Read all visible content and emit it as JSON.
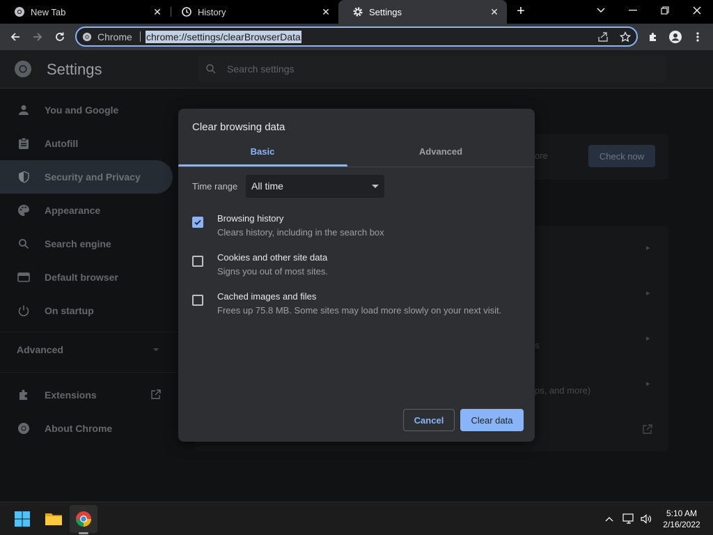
{
  "browser": {
    "tabs": [
      {
        "label": "New Tab",
        "icon": "chrome-icon",
        "active": false
      },
      {
        "label": "History",
        "icon": "history-icon",
        "active": false
      },
      {
        "label": "Settings",
        "icon": "gear-icon",
        "active": true
      }
    ],
    "omnibox": {
      "chip_label": "Chrome",
      "url": "chrome://settings/clearBrowserData"
    }
  },
  "settings": {
    "title": "Settings",
    "search_placeholder": "Search settings",
    "sidebar": {
      "items": [
        {
          "label": "You and Google",
          "icon": "person-icon"
        },
        {
          "label": "Autofill",
          "icon": "clipboard-icon"
        },
        {
          "label": "Security and Privacy",
          "icon": "shield-icon",
          "active": true
        },
        {
          "label": "Appearance",
          "icon": "palette-icon"
        },
        {
          "label": "Search engine",
          "icon": "search-icon"
        },
        {
          "label": "Default browser",
          "icon": "browser-window-icon"
        },
        {
          "label": "On startup",
          "icon": "power-icon"
        }
      ],
      "advanced_label": "Advanced",
      "footer_items": [
        {
          "label": "Extensions",
          "icon": "puzzle-icon"
        },
        {
          "label": "About Chrome",
          "icon": "chrome-icon"
        }
      ]
    },
    "background": {
      "check_now_label": "Check now",
      "partial_text_1": "ore",
      "partial_text_2": "s",
      "partial_text_3": "ps, and more)"
    }
  },
  "dialog": {
    "title": "Clear browsing data",
    "tabs": [
      "Basic",
      "Advanced"
    ],
    "active_tab": "Basic",
    "time_range_label": "Time range",
    "time_range_value": "All time",
    "options": [
      {
        "title": "Browsing history",
        "description": "Clears history, including in the search box",
        "checked": true
      },
      {
        "title": "Cookies and other site data",
        "description": "Signs you out of most sites.",
        "checked": false
      },
      {
        "title": "Cached images and files",
        "description": "Frees up 75.8 MB. Some sites may load more slowly on your next visit.",
        "checked": false
      }
    ],
    "cancel_label": "Cancel",
    "clear_label": "Clear data"
  },
  "taskbar": {
    "time": "5:10 AM",
    "date": "2/16/2022"
  },
  "colors": {
    "accent": "#8ab4f8",
    "dialog_bg": "#2e2f33",
    "page_bg": "#1b1c1e"
  }
}
